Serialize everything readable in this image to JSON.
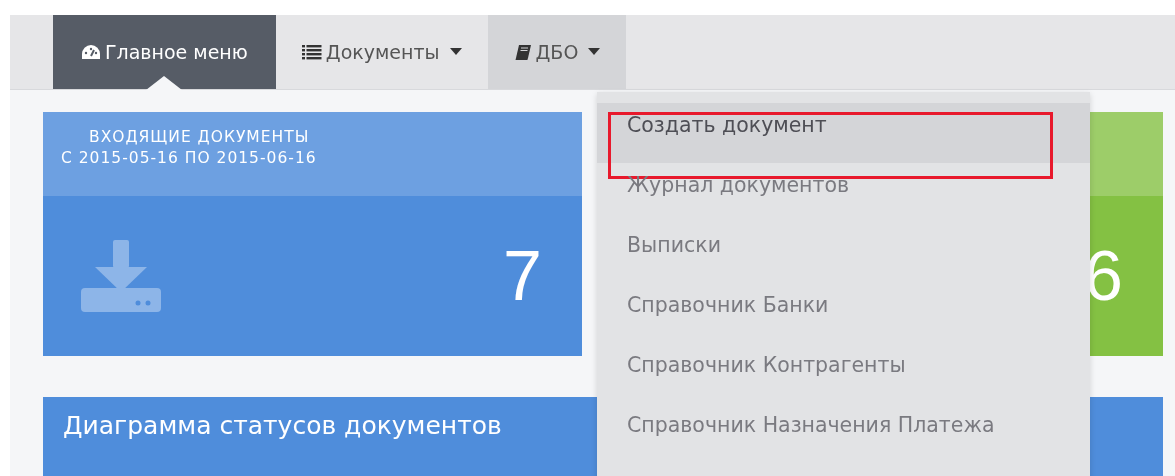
{
  "nav": {
    "items": [
      {
        "label": "Главное меню",
        "dropdown": false,
        "selected": true,
        "open": false
      },
      {
        "label": "Документы",
        "dropdown": true,
        "selected": false,
        "open": false
      },
      {
        "label": "ДБО",
        "dropdown": true,
        "selected": false,
        "open": true
      }
    ]
  },
  "cards": [
    {
      "title": "ВХОДЯЩИЕ ДОКУМЕНТЫ",
      "subtitle": "С 2015-05-16 ПО 2015-06-16",
      "value": "7",
      "color": "#4f8ddb"
    },
    {
      "value": "6",
      "color": "#84c143"
    }
  ],
  "panel": {
    "title": "Диаграмма статусов документов"
  },
  "dropdown_menu": {
    "items": [
      {
        "label": "Создать документ",
        "selected": true,
        "outlined": true
      },
      {
        "label": "Журнал документов",
        "selected": false,
        "outlined": false
      },
      {
        "label": "Выписки",
        "selected": false,
        "outlined": false
      },
      {
        "label": "Справочник Банки",
        "selected": false,
        "outlined": false
      },
      {
        "label": "Справочник Контрагенты",
        "selected": false,
        "outlined": false
      },
      {
        "label": "Справочник Назначения Платежа",
        "selected": false,
        "outlined": false
      }
    ]
  }
}
